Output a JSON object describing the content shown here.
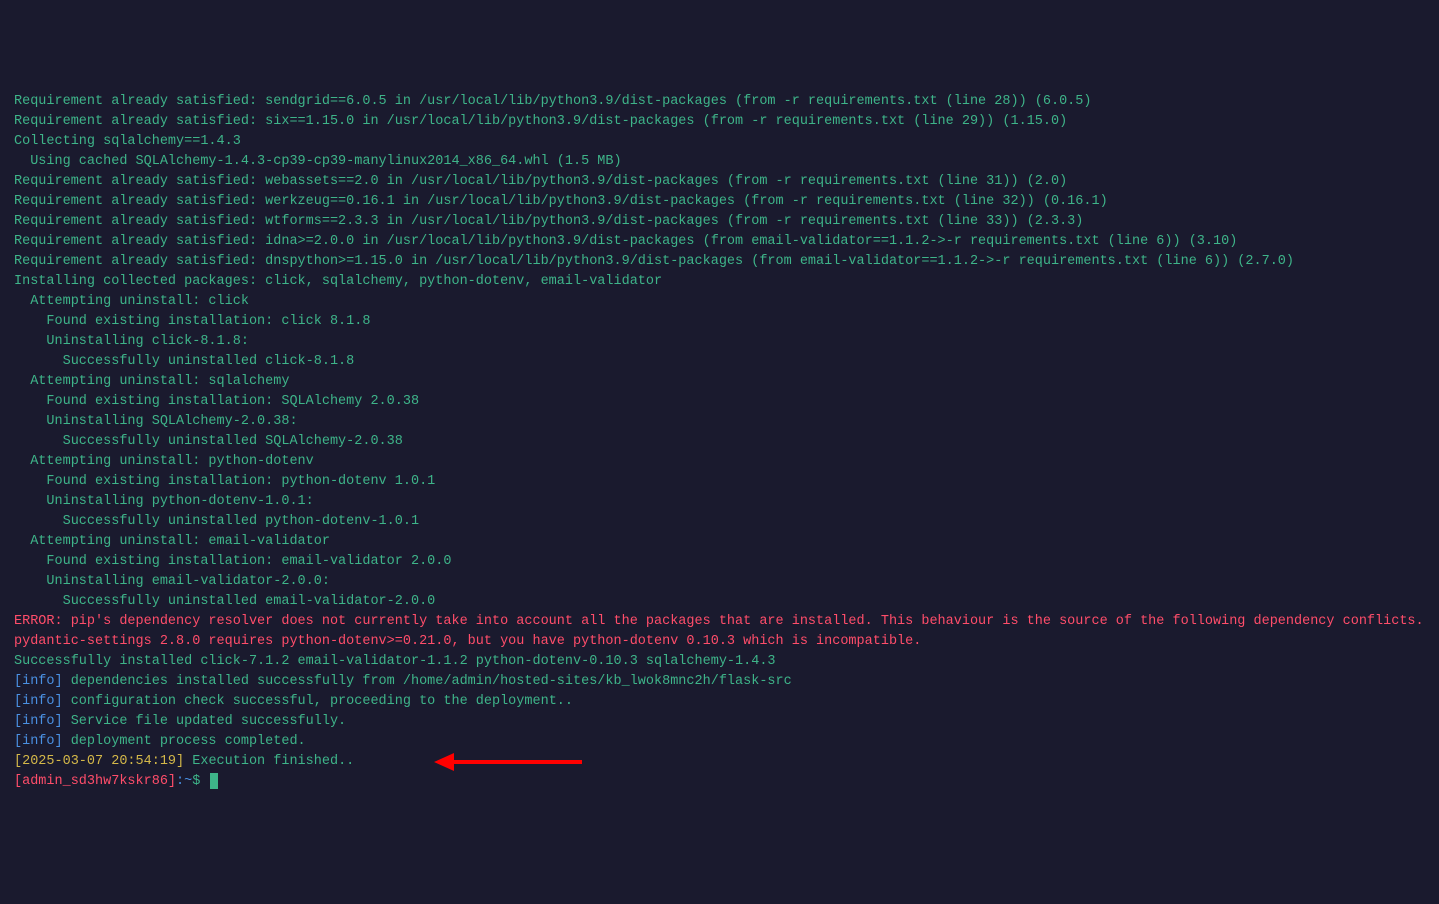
{
  "lines": [
    {
      "cls": "teal",
      "text": "Requirement already satisfied: sendgrid==6.0.5 in /usr/local/lib/python3.9/dist-packages (from -r requirements.txt (line 28)) (6.0.5)"
    },
    {
      "cls": "teal",
      "text": "Requirement already satisfied: six==1.15.0 in /usr/local/lib/python3.9/dist-packages (from -r requirements.txt (line 29)) (1.15.0)"
    },
    {
      "cls": "teal",
      "text": "Collecting sqlalchemy==1.4.3"
    },
    {
      "cls": "teal",
      "text": "  Using cached SQLAlchemy-1.4.3-cp39-cp39-manylinux2014_x86_64.whl (1.5 MB)"
    },
    {
      "cls": "teal",
      "text": "Requirement already satisfied: webassets==2.0 in /usr/local/lib/python3.9/dist-packages (from -r requirements.txt (line 31)) (2.0)"
    },
    {
      "cls": "teal",
      "text": "Requirement already satisfied: werkzeug==0.16.1 in /usr/local/lib/python3.9/dist-packages (from -r requirements.txt (line 32)) (0.16.1)"
    },
    {
      "cls": "teal",
      "text": "Requirement already satisfied: wtforms==2.3.3 in /usr/local/lib/python3.9/dist-packages (from -r requirements.txt (line 33)) (2.3.3)"
    },
    {
      "cls": "teal",
      "text": "Requirement already satisfied: idna>=2.0.0 in /usr/local/lib/python3.9/dist-packages (from email-validator==1.1.2->-r requirements.txt (line 6)) (3.10)"
    },
    {
      "cls": "teal",
      "text": "Requirement already satisfied: dnspython>=1.15.0 in /usr/local/lib/python3.9/dist-packages (from email-validator==1.1.2->-r requirements.txt (line 6)) (2.7.0)"
    },
    {
      "cls": "teal",
      "text": "Installing collected packages: click, sqlalchemy, python-dotenv, email-validator"
    },
    {
      "cls": "teal",
      "text": "  Attempting uninstall: click"
    },
    {
      "cls": "teal",
      "text": "    Found existing installation: click 8.1.8"
    },
    {
      "cls": "teal",
      "text": "    Uninstalling click-8.1.8:"
    },
    {
      "cls": "teal",
      "text": "      Successfully uninstalled click-8.1.8"
    },
    {
      "cls": "teal",
      "text": "  Attempting uninstall: sqlalchemy"
    },
    {
      "cls": "teal",
      "text": "    Found existing installation: SQLAlchemy 2.0.38"
    },
    {
      "cls": "teal",
      "text": "    Uninstalling SQLAlchemy-2.0.38:"
    },
    {
      "cls": "teal",
      "text": "      Successfully uninstalled SQLAlchemy-2.0.38"
    },
    {
      "cls": "teal",
      "text": "  Attempting uninstall: python-dotenv"
    },
    {
      "cls": "teal",
      "text": "    Found existing installation: python-dotenv 1.0.1"
    },
    {
      "cls": "teal",
      "text": "    Uninstalling python-dotenv-1.0.1:"
    },
    {
      "cls": "teal",
      "text": "      Successfully uninstalled python-dotenv-1.0.1"
    },
    {
      "cls": "teal",
      "text": "  Attempting uninstall: email-validator"
    },
    {
      "cls": "teal",
      "text": "    Found existing installation: email-validator 2.0.0"
    },
    {
      "cls": "teal",
      "text": "    Uninstalling email-validator-2.0.0:"
    },
    {
      "cls": "teal",
      "text": "      Successfully uninstalled email-validator-2.0.0"
    },
    {
      "cls": "red",
      "text": "ERROR: pip's dependency resolver does not currently take into account all the packages that are installed. This behaviour is the source of the following dependency conflicts."
    },
    {
      "cls": "red",
      "text": "pydantic-settings 2.8.0 requires python-dotenv>=0.21.0, but you have python-dotenv 0.10.3 which is incompatible."
    },
    {
      "cls": "teal",
      "text": "Successfully installed click-7.1.2 email-validator-1.1.2 python-dotenv-0.10.3 sqlalchemy-1.4.3"
    }
  ],
  "infoLines": [
    {
      "tag": "[info]",
      "msg": " dependencies installed successfully from /home/admin/hosted-sites/kb_lwok8mnc2h/flask-src"
    },
    {
      "tag": "[info]",
      "msg": " configuration check successful, proceeding to the deployment.."
    },
    {
      "tag": "[info]",
      "msg": " Service file updated successfully."
    },
    {
      "tag": "[info]",
      "msg": " deployment process completed."
    }
  ],
  "timestamp": {
    "bracket": "[2025-03-07 20:54:19]",
    "msg": " Execution finished.."
  },
  "prompt": {
    "user": "[admin_sd3hw7kskr86]",
    "path": ":~",
    "symbol": "$ "
  }
}
